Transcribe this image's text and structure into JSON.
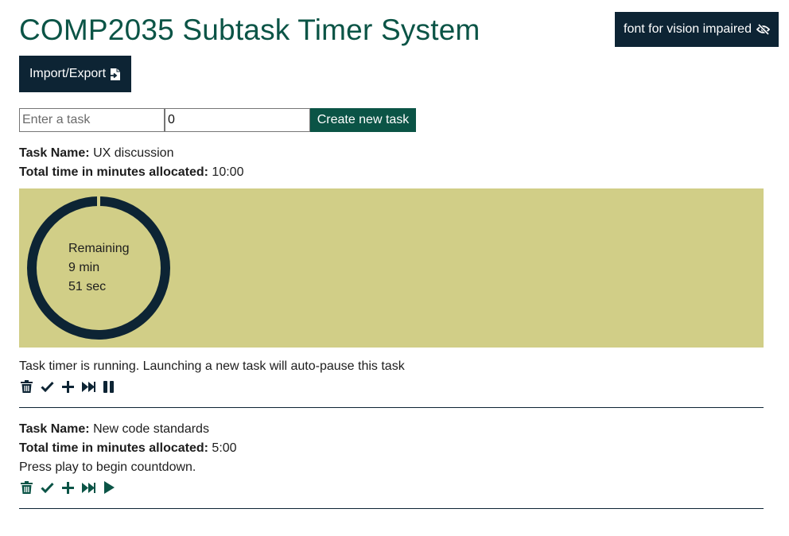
{
  "header": {
    "title": "COMP2035 Subtask Timer System",
    "vision_button_label": "font for vision impaired",
    "vision_icon": "eye-slash-icon",
    "import_button_label": "Import/Export",
    "import_icon": "file-import-icon"
  },
  "form": {
    "task_placeholder": "Enter a task",
    "task_value": "",
    "minutes_value": "0",
    "create_label": "Create new task"
  },
  "labels": {
    "task_name": "Task Name:",
    "total_time": "Total time in minutes allocated:"
  },
  "tasks": [
    {
      "name": "UX discussion",
      "total": "10:00",
      "remaining_label": "Remaining",
      "remaining_min": "9 min",
      "remaining_sec": "51 sec",
      "status": "Task timer is running. Launching a new task will auto-pause this task",
      "toggle_icon": "pause-icon"
    },
    {
      "name": "New code standards",
      "total": "5:00",
      "status": "Press play to begin countdown.",
      "toggle_icon": "play-icon"
    }
  ],
  "colors": {
    "primary_dark": "#0d2434",
    "accent_green": "#0b5446",
    "timer_panel": "#d1ce87"
  }
}
